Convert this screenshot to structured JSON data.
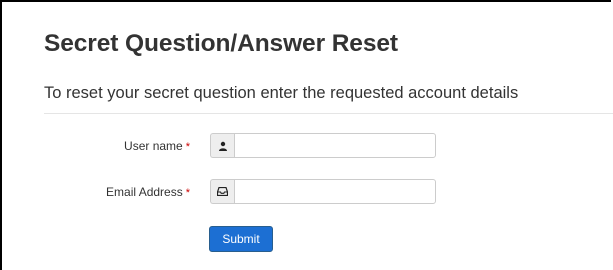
{
  "page": {
    "title": "Secret Question/Answer Reset",
    "subtitle": "To reset your secret question enter the requested account details"
  },
  "form": {
    "username": {
      "label": "User name",
      "required_marker": "*",
      "icon": "user-icon",
      "value": "",
      "placeholder": ""
    },
    "email": {
      "label": "Email Address",
      "required_marker": "*",
      "icon": "inbox-icon",
      "value": "",
      "placeholder": ""
    },
    "submit_label": "Submit"
  },
  "colors": {
    "button_bg": "#1c6fd3",
    "required": "#cc0000",
    "addon_bg": "#eeeeee"
  }
}
